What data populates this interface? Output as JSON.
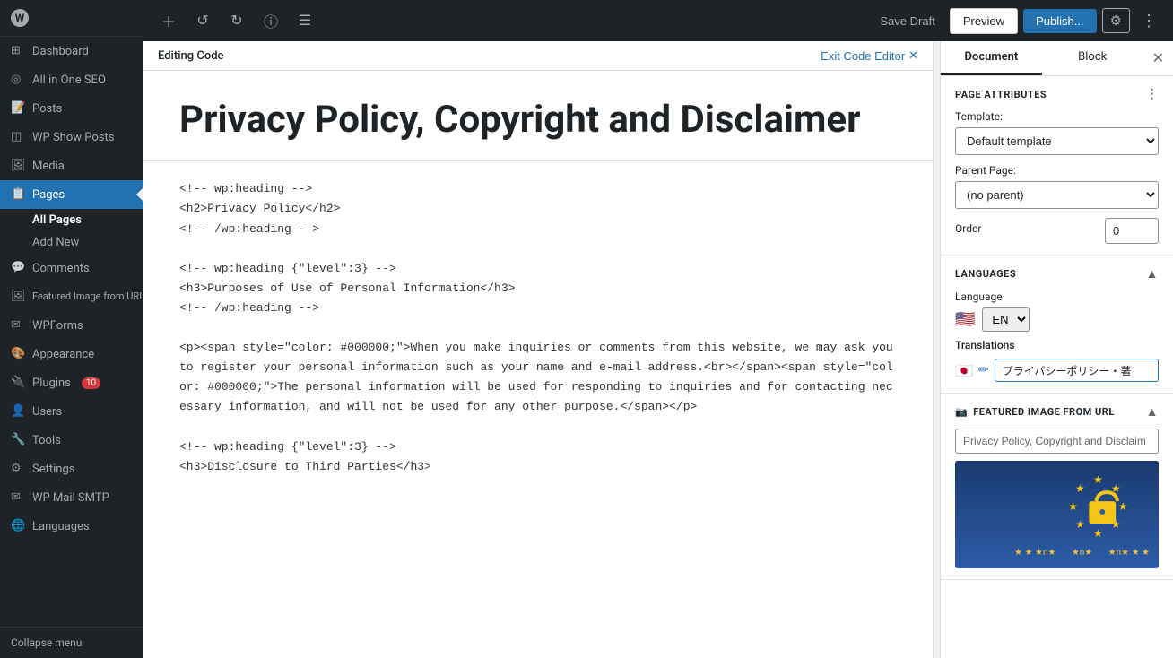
{
  "sidebar": {
    "items": [
      {
        "label": "Dashboard",
        "icon": "⊞",
        "active": false,
        "name": "dashboard"
      },
      {
        "label": "All in One SEO",
        "icon": "◎",
        "active": false,
        "name": "all-in-one-seo"
      },
      {
        "label": "Posts",
        "icon": "📄",
        "active": false,
        "name": "posts"
      },
      {
        "label": "WP Show Posts",
        "icon": "◫",
        "active": false,
        "name": "wp-show-posts"
      },
      {
        "label": "Media",
        "icon": "🖼",
        "active": false,
        "name": "media"
      },
      {
        "label": "Pages",
        "icon": "📋",
        "active": true,
        "name": "pages"
      },
      {
        "label": "Comments",
        "icon": "💬",
        "active": false,
        "name": "comments"
      },
      {
        "label": "Featured Image from URL",
        "icon": "🖼",
        "active": false,
        "name": "featured-image-from-url"
      },
      {
        "label": "WPForms",
        "icon": "✉",
        "active": false,
        "name": "wpforms"
      },
      {
        "label": "Appearance",
        "icon": "🎨",
        "active": false,
        "name": "appearance"
      },
      {
        "label": "Plugins",
        "icon": "🔌",
        "active": false,
        "name": "plugins",
        "badge": "10"
      },
      {
        "label": "Users",
        "icon": "👤",
        "active": false,
        "name": "users"
      },
      {
        "label": "Tools",
        "icon": "🔧",
        "active": false,
        "name": "tools"
      },
      {
        "label": "Settings",
        "icon": "⚙",
        "active": false,
        "name": "settings"
      },
      {
        "label": "WP Mail SMTP",
        "icon": "✉",
        "active": false,
        "name": "wp-mail-smtp"
      },
      {
        "label": "Languages",
        "icon": "🌐",
        "active": false,
        "name": "languages"
      }
    ],
    "pages_submenu": [
      {
        "label": "All Pages",
        "active": true
      },
      {
        "label": "Add New",
        "active": false
      }
    ],
    "collapse_label": "Collapse menu"
  },
  "toolbar": {
    "save_draft_label": "Save Draft",
    "preview_label": "Preview",
    "publish_label": "Publish...",
    "exit_code_editor_label": "Exit Code Editor"
  },
  "code_editor": {
    "header_label": "Editing Code",
    "page_title": "Privacy Policy, Copyright and Disclaimer",
    "code_content": "<!-- wp:heading -->\n<h2>Privacy Policy</h2>\n<!-- /wp:heading -->\n\n<!-- wp:heading {\"level\":3} -->\n<h3>Purposes of Use of Personal Information</h3>\n<!-- /wp:heading -->\n\n<p><span style=\"color: #000000;\">When you make inquiries or comments from this website, we may ask you to register your personal information such as your name and e-mail address.<br></span><span style=\"color: #000000;\">The personal information will be used for responding to inquiries and for contacting necessary information, and will not be used for any other purpose.</span></p>\n\n<!-- wp:heading {\"level\":3} -->\n<h3>Disclosure to Third Parties</h3>"
  },
  "right_panel": {
    "tabs": [
      {
        "label": "Document",
        "active": true
      },
      {
        "label": "Block",
        "active": false
      }
    ],
    "page_attributes": {
      "section_label": "Page Attributes",
      "template_label": "Template:",
      "template_value": "Default template",
      "template_options": [
        "Default template"
      ],
      "parent_label": "Parent Page:",
      "parent_value": "(no parent)",
      "parent_options": [
        "(no parent)"
      ],
      "order_label": "Order",
      "order_value": "0"
    },
    "languages": {
      "section_label": "Languages",
      "language_label": "Language",
      "flag": "🇺🇸",
      "lang_code": "EN",
      "translations_label": "Translations",
      "translation_flag": "🇯🇵",
      "translation_text": "プライバシーポリシー・著"
    },
    "featured_image_from_url": {
      "section_label": "Featured Image from URL",
      "input_placeholder": "Privacy Policy, Copyright and Disclaim"
    }
  }
}
